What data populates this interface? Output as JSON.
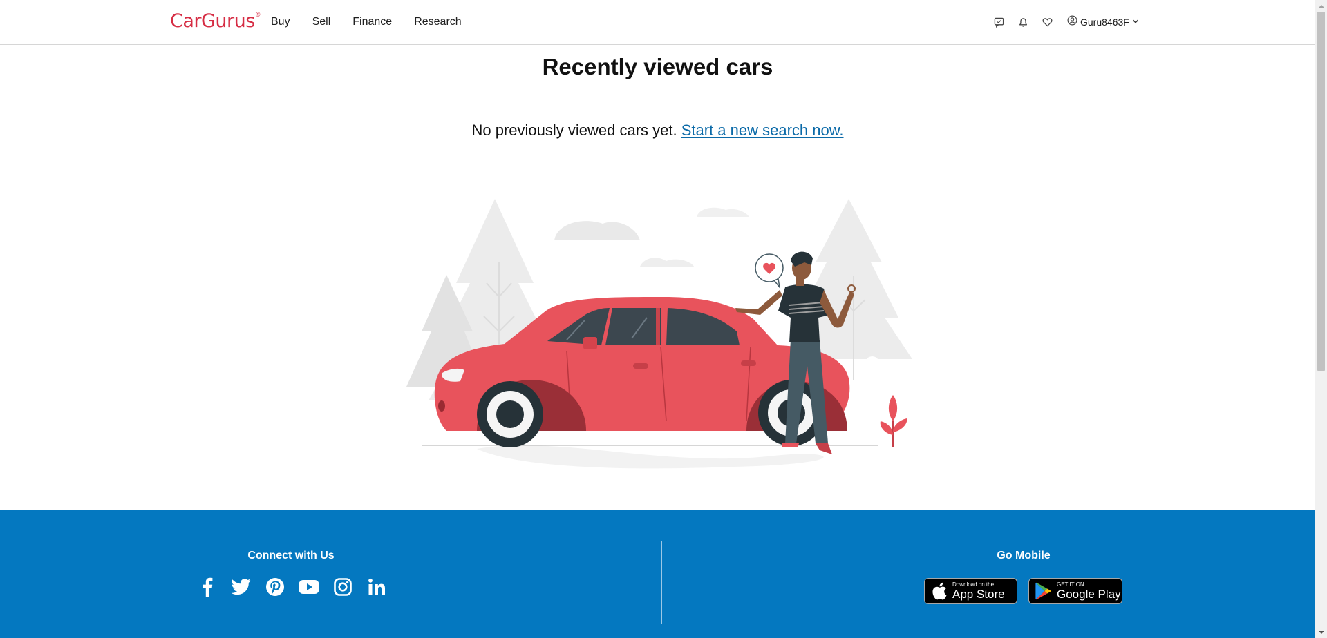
{
  "header": {
    "logo_text": "CarGurus",
    "logo_reg": "®",
    "nav": [
      "Buy",
      "Sell",
      "Finance",
      "Research"
    ],
    "icons": [
      "messages-icon",
      "bell-icon",
      "heart-icon"
    ],
    "username": "Guru8463F"
  },
  "main": {
    "title": "Recently viewed cars",
    "empty_text": "No previously viewed cars yet.",
    "search_link": "Start a new search now."
  },
  "footer": {
    "connect_title": "Connect with Us",
    "social": [
      "facebook-icon",
      "twitter-icon",
      "pinterest-icon",
      "youtube-icon",
      "instagram-icon",
      "linkedin-icon"
    ],
    "mobile_title": "Go Mobile",
    "app_store": {
      "small": "Download on the",
      "big": "App Store"
    },
    "google_play": {
      "small": "GET IT ON",
      "big": "Google Play"
    }
  },
  "colors": {
    "brand_red": "#d62d44",
    "link_blue": "#0b6aa8",
    "footer_blue": "#0478c0",
    "car_red": "#e8535c"
  }
}
